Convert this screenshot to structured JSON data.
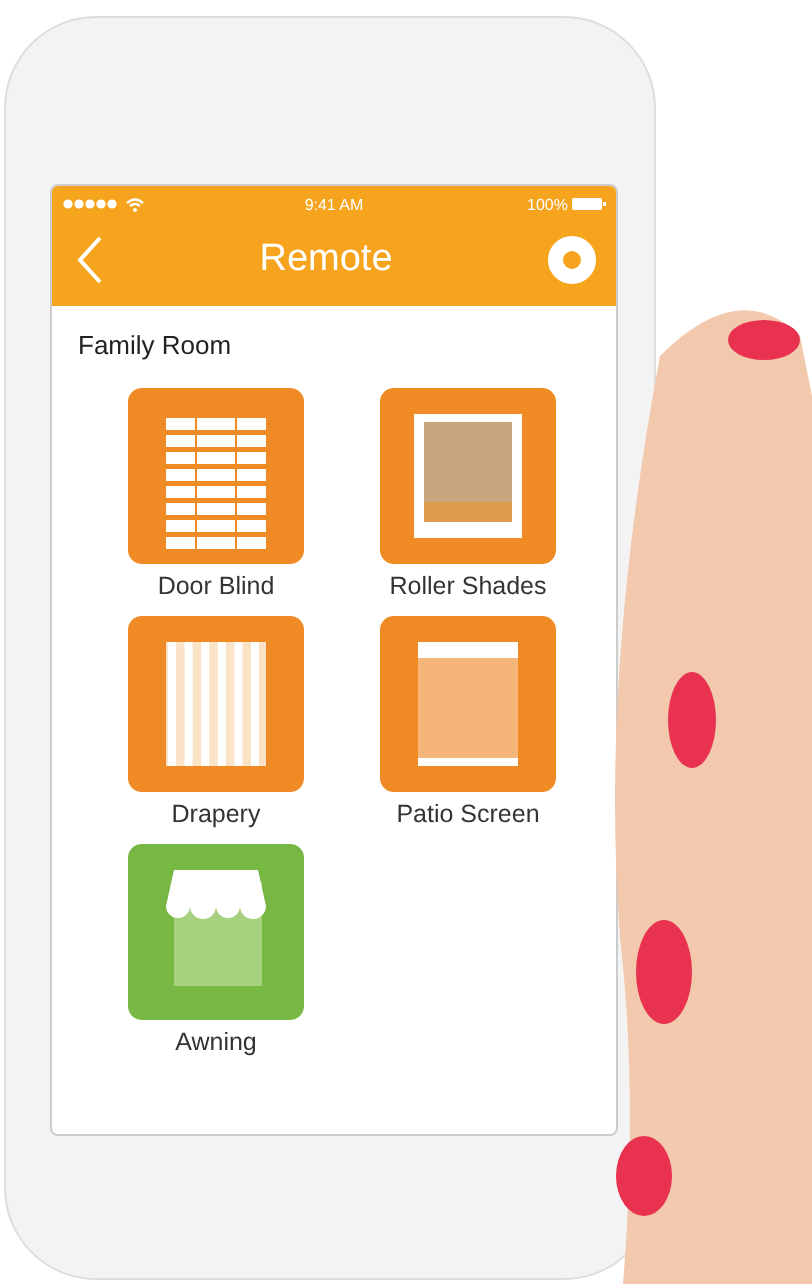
{
  "status_bar": {
    "time": "9:41 AM",
    "battery": "100%"
  },
  "nav_bar": {
    "title": "Remote"
  },
  "room": {
    "title": "Family Room"
  },
  "devices": [
    {
      "label": "Door Blind",
      "kind": "blind",
      "color": "#f08a24"
    },
    {
      "label": "Roller Shades",
      "kind": "roller",
      "color": "#f08a24"
    },
    {
      "label": "Drapery",
      "kind": "drapery",
      "color": "#f08a24"
    },
    {
      "label": "Patio Screen",
      "kind": "screen",
      "color": "#f08a24"
    },
    {
      "label": "Awning",
      "kind": "awning",
      "color": "#76b843"
    }
  ]
}
